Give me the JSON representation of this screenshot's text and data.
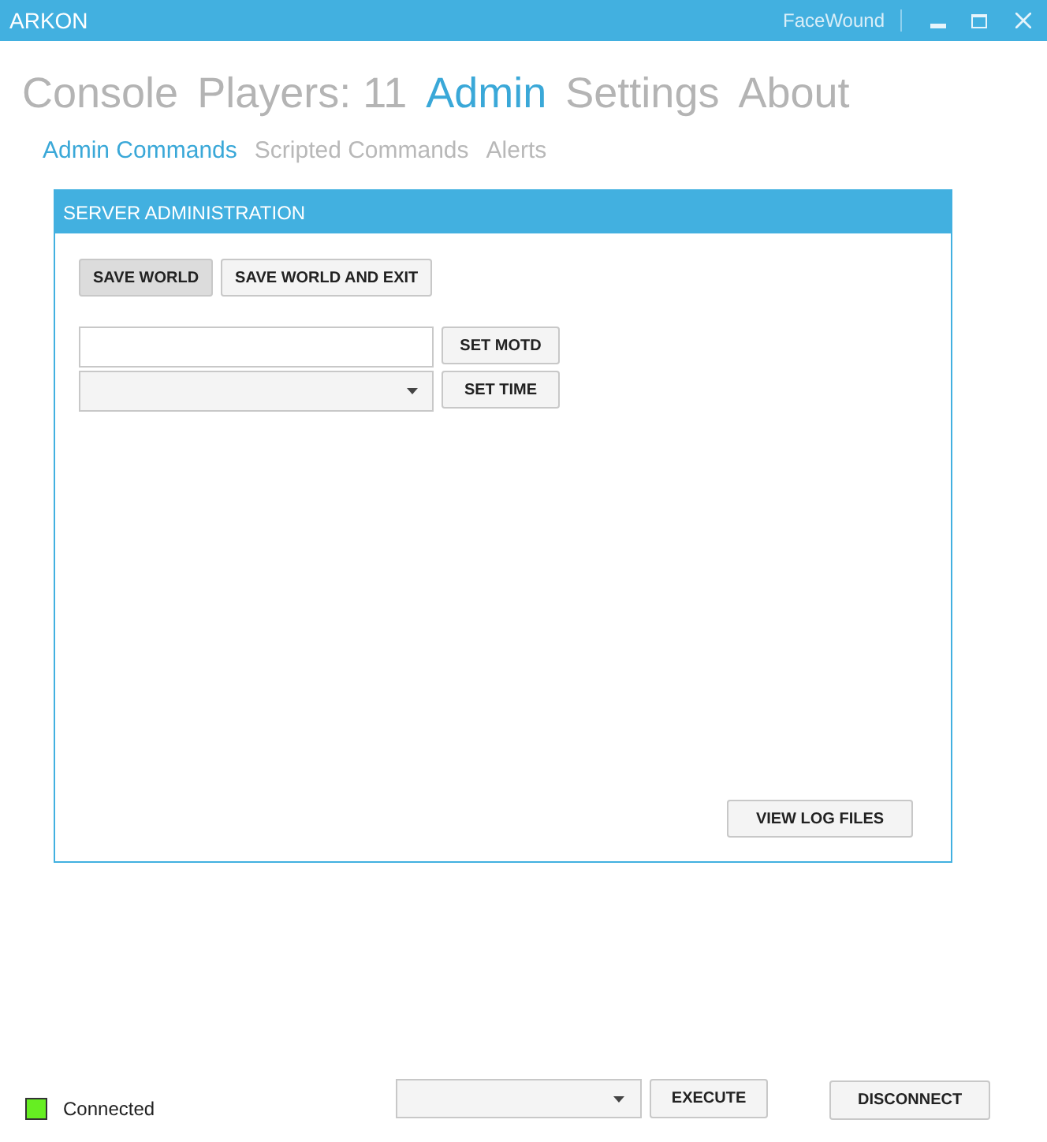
{
  "window": {
    "title": "ARKON",
    "user": "FaceWound"
  },
  "nav_tabs": [
    {
      "label": "Console",
      "selected": false
    },
    {
      "label": "Players: 11",
      "selected": false
    },
    {
      "label": "Admin",
      "selected": true
    },
    {
      "label": "Settings",
      "selected": false
    },
    {
      "label": "About",
      "selected": false
    }
  ],
  "sub_tabs": [
    {
      "label": "Admin Commands",
      "selected": true
    },
    {
      "label": "Scripted Commands",
      "selected": false
    },
    {
      "label": "Alerts",
      "selected": false
    }
  ],
  "panel": {
    "title": "SERVER ADMINISTRATION",
    "world_buttons": [
      {
        "label": "SAVE WORLD",
        "highlighted": true
      },
      {
        "label": "SAVE WORLD AND EXIT",
        "highlighted": false
      }
    ],
    "motd_button": "SET MOTD",
    "time_button": "SET TIME",
    "log_button": "VIEW LOG FILES"
  },
  "status": {
    "label": "Connected",
    "color": "#66ee22"
  },
  "execute_button": "EXECUTE",
  "disconnect_button": "DISCONNECT"
}
